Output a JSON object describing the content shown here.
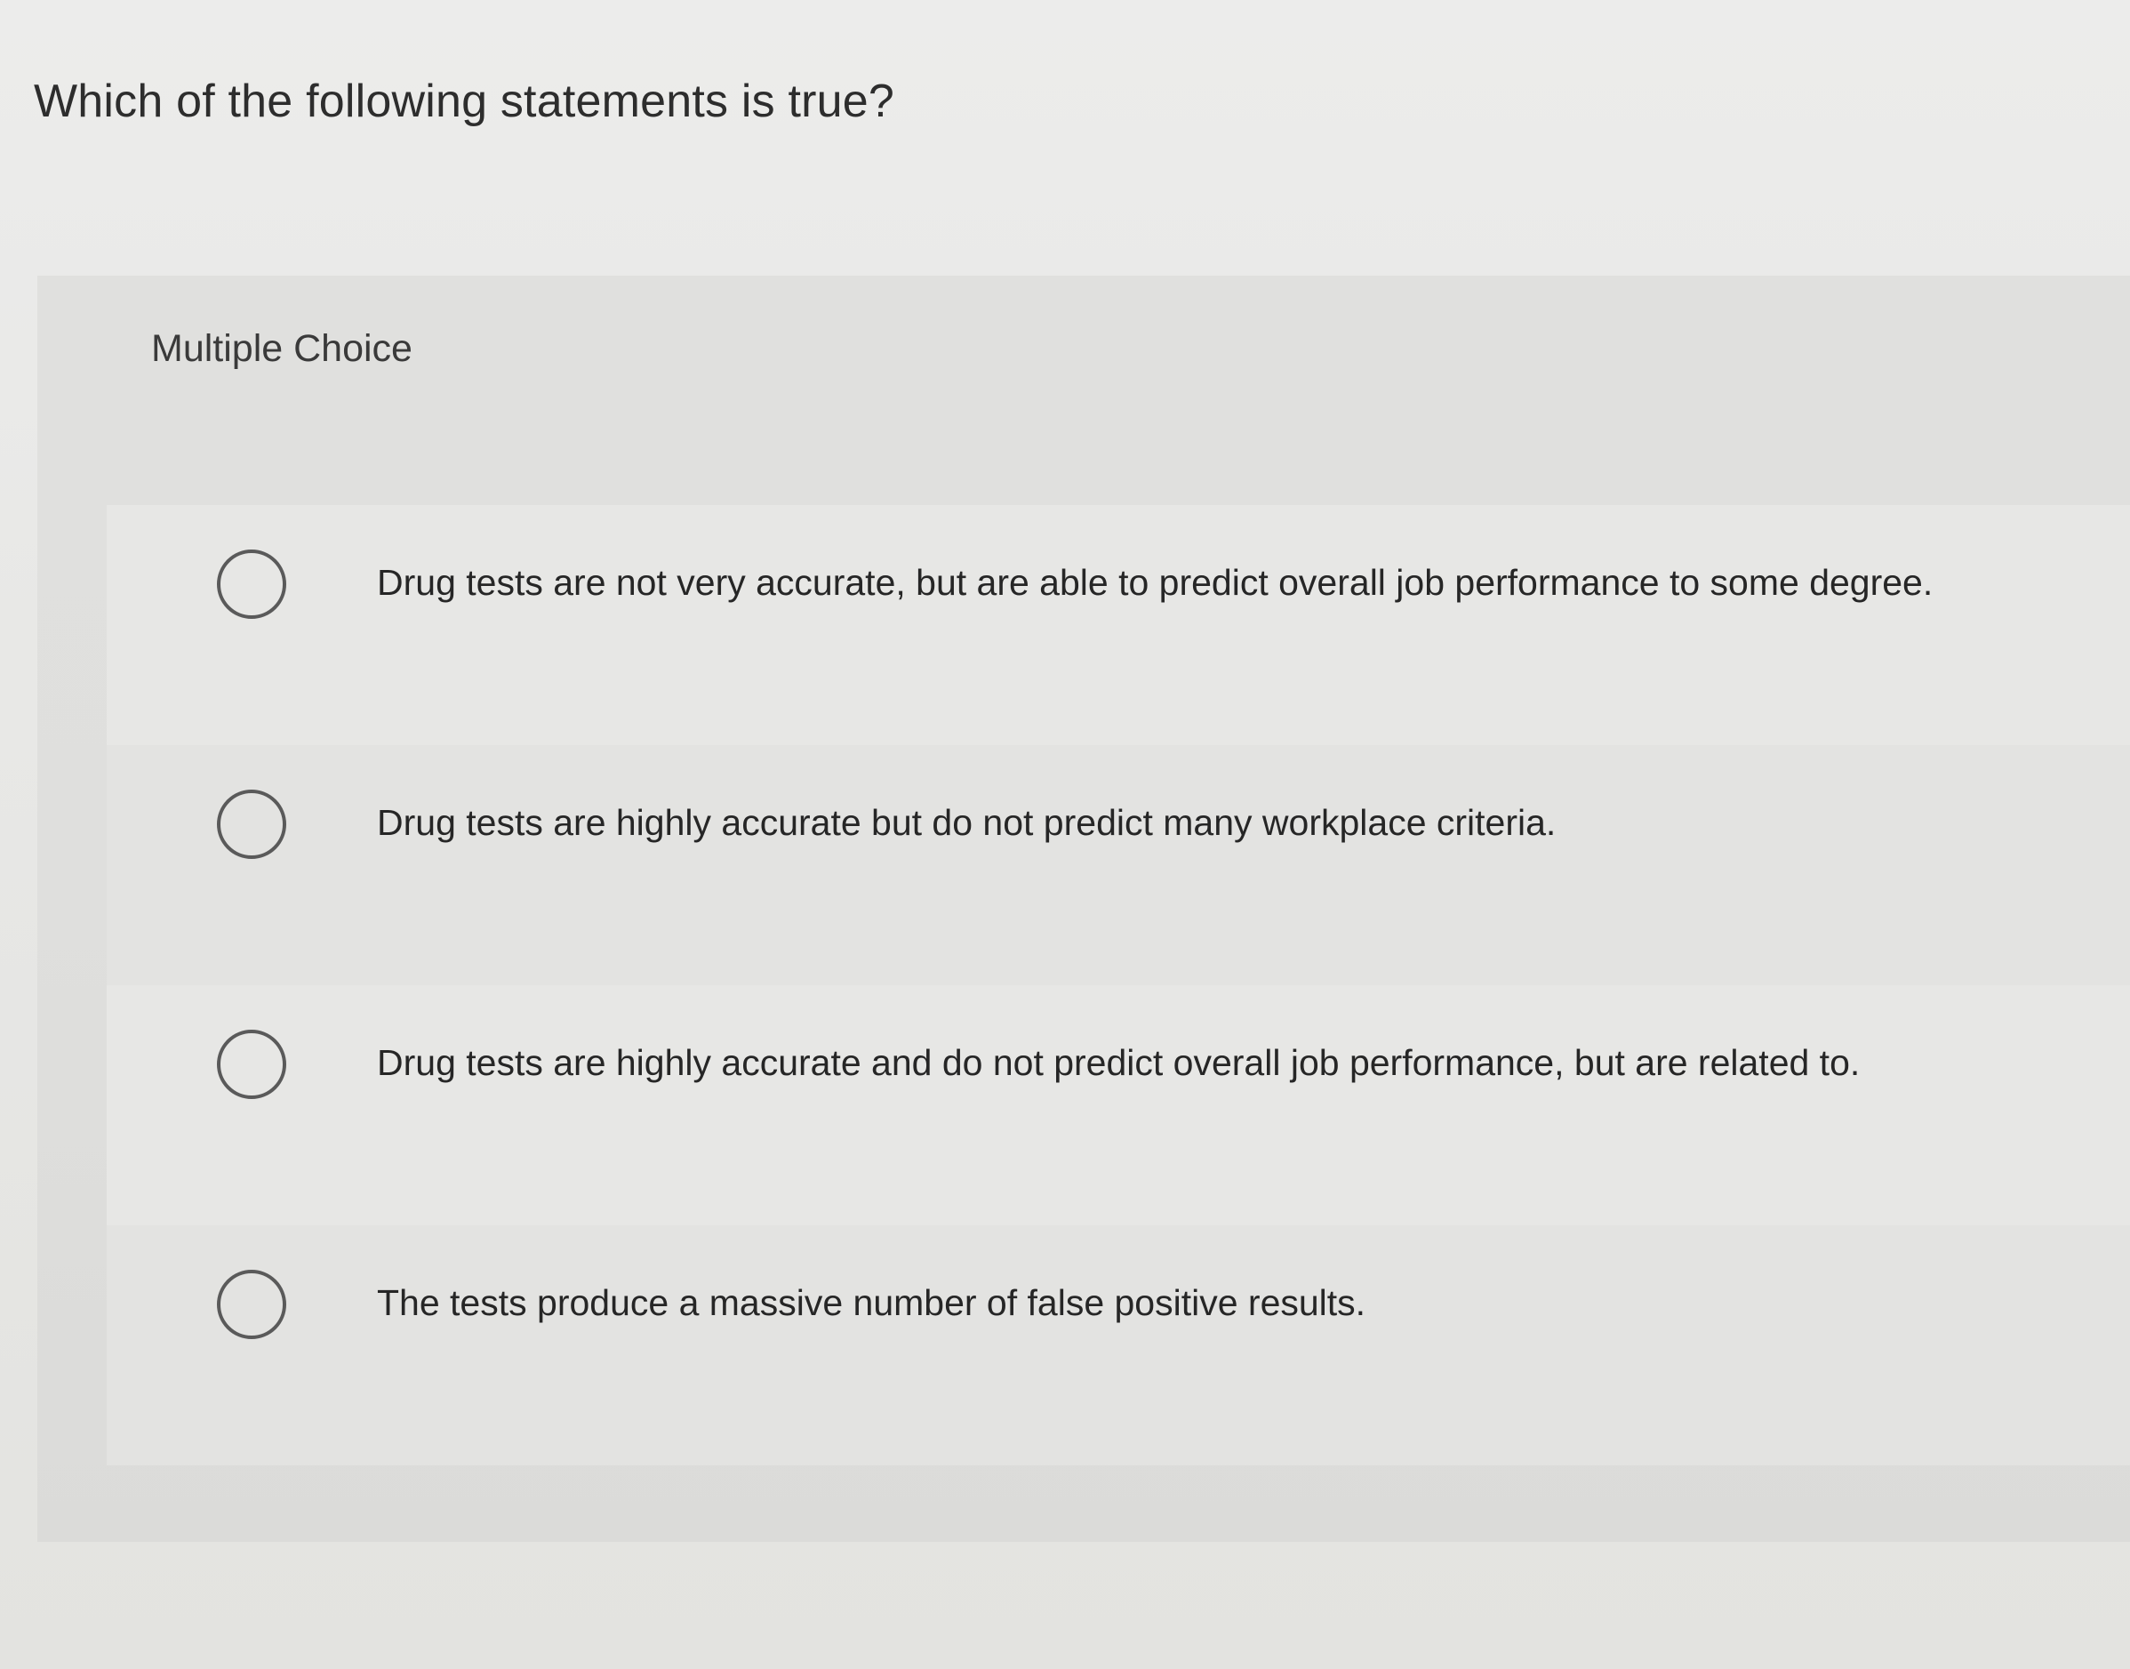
{
  "question": {
    "text": "Which of the following statements is true?"
  },
  "answer_panel": {
    "type_label": "Multiple Choice",
    "options": [
      {
        "label": "Drug tests are not very accurate, but are able to predict overall job performance to some degree.",
        "selected": false
      },
      {
        "label": "Drug tests are highly accurate but do not predict many workplace criteria.",
        "selected": false
      },
      {
        "label": "Drug tests are highly accurate and do not predict overall job performance, but are related to.",
        "selected": false
      },
      {
        "label": "The tests produce a massive number of false positive results.",
        "selected": false
      }
    ]
  }
}
